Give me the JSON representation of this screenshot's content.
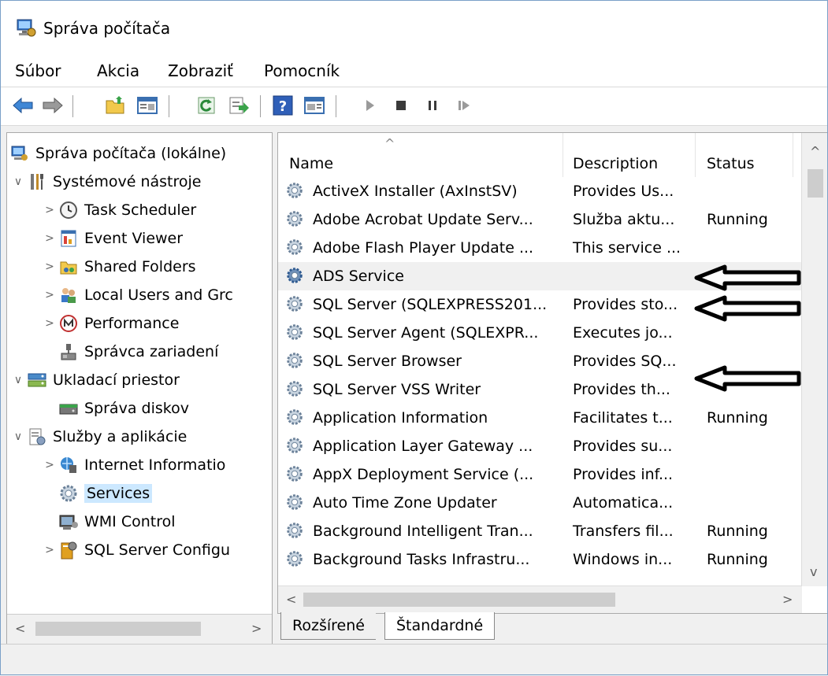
{
  "window": {
    "title": "Správa počítača"
  },
  "menu": {
    "items": [
      "Súbor",
      "Akcia",
      "Zobraziť",
      "Pomocník"
    ]
  },
  "toolbar": {
    "buttons": [
      "back-arrow-icon",
      "forward-arrow-icon",
      "up-folder-icon",
      "show-hide-tree-icon",
      "refresh-icon",
      "export-list-icon",
      "help-icon",
      "show-action-pane-icon",
      "play-icon",
      "stop-icon",
      "pause-icon",
      "restart-icon"
    ]
  },
  "tree": {
    "items": [
      {
        "label": "Správa počítača (lokálne)",
        "toggle": "",
        "icon": "computer-management-icon"
      },
      {
        "label": "Systémové nástroje",
        "toggle": "∨",
        "icon": "system-tools-icon"
      },
      {
        "label": "Task Scheduler",
        "toggle": ">",
        "icon": "clock-icon"
      },
      {
        "label": "Event Viewer",
        "toggle": ">",
        "icon": "event-viewer-icon"
      },
      {
        "label": "Shared Folders",
        "toggle": ">",
        "icon": "shared-folders-icon"
      },
      {
        "label": "Local Users and Grc",
        "toggle": ">",
        "icon": "users-icon"
      },
      {
        "label": "Performance",
        "toggle": ">",
        "icon": "performance-icon"
      },
      {
        "label": "Správca zariadení",
        "toggle": "",
        "icon": "device-manager-icon"
      },
      {
        "label": "Ukladací priestor",
        "toggle": "∨",
        "icon": "storage-icon"
      },
      {
        "label": "Správa diskov",
        "toggle": "",
        "icon": "disk-icon"
      },
      {
        "label": "Služby a aplikácie",
        "toggle": "∨",
        "icon": "services-apps-icon"
      },
      {
        "label": "Internet Informatio",
        "toggle": ">",
        "icon": "iis-icon"
      },
      {
        "label": "Services",
        "toggle": "",
        "icon": "services-gear-icon"
      },
      {
        "label": "WMI Control",
        "toggle": "",
        "icon": "wmi-icon"
      },
      {
        "label": "SQL Server Configu",
        "toggle": ">",
        "icon": "sql-config-icon"
      }
    ]
  },
  "list": {
    "columns": [
      "Name",
      "Description",
      "Status"
    ],
    "rows": [
      {
        "name": "ActiveX Installer (AxInstSV)",
        "description": "Provides Us...",
        "status": ""
      },
      {
        "name": "Adobe Acrobat Update Serv...",
        "description": "Služba aktu...",
        "status": "Running"
      },
      {
        "name": "Adobe Flash Player Update ...",
        "description": "This service ...",
        "status": ""
      },
      {
        "name": "ADS Service",
        "description": "",
        "status": ""
      },
      {
        "name": "SQL Server (SQLEXPRESS201...",
        "description": "Provides sto...",
        "status": ""
      },
      {
        "name": "SQL Server Agent (SQLEXPR...",
        "description": "Executes jo...",
        "status": ""
      },
      {
        "name": "SQL Server Browser",
        "description": "Provides SQ...",
        "status": ""
      },
      {
        "name": "SQL Server VSS Writer",
        "description": "Provides th...",
        "status": ""
      },
      {
        "name": "Application Information",
        "description": "Facilitates t...",
        "status": "Running"
      },
      {
        "name": "Application Layer Gateway ...",
        "description": "Provides su...",
        "status": ""
      },
      {
        "name": "AppX Deployment Service (...",
        "description": "Provides inf...",
        "status": ""
      },
      {
        "name": "Auto Time Zone Updater",
        "description": "Automatica...",
        "status": ""
      },
      {
        "name": "Background Intelligent Tran...",
        "description": "Transfers fil...",
        "status": "Running"
      },
      {
        "name": "Background Tasks Infrastru...",
        "description": "Windows in...",
        "status": "Running"
      }
    ]
  },
  "tabs": [
    "Rozšírené",
    "Štandardné"
  ],
  "colors": {
    "selection": "#cce8ff",
    "row_highlight": "#f0f0f0",
    "accent_blue": "#2f6fc0"
  }
}
